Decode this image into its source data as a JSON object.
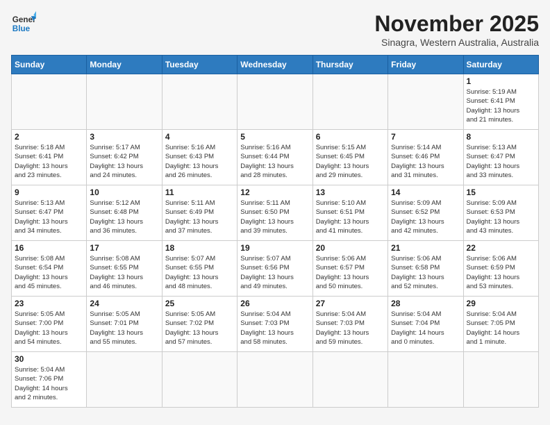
{
  "header": {
    "logo_general": "General",
    "logo_blue": "Blue",
    "month_title": "November 2025",
    "subtitle": "Sinagra, Western Australia, Australia"
  },
  "days_of_week": [
    "Sunday",
    "Monday",
    "Tuesday",
    "Wednesday",
    "Thursday",
    "Friday",
    "Saturday"
  ],
  "weeks": [
    [
      {
        "day": "",
        "info": ""
      },
      {
        "day": "",
        "info": ""
      },
      {
        "day": "",
        "info": ""
      },
      {
        "day": "",
        "info": ""
      },
      {
        "day": "",
        "info": ""
      },
      {
        "day": "",
        "info": ""
      },
      {
        "day": "1",
        "info": "Sunrise: 5:19 AM\nSunset: 6:41 PM\nDaylight: 13 hours\nand 21 minutes."
      }
    ],
    [
      {
        "day": "2",
        "info": "Sunrise: 5:18 AM\nSunset: 6:41 PM\nDaylight: 13 hours\nand 23 minutes."
      },
      {
        "day": "3",
        "info": "Sunrise: 5:17 AM\nSunset: 6:42 PM\nDaylight: 13 hours\nand 24 minutes."
      },
      {
        "day": "4",
        "info": "Sunrise: 5:16 AM\nSunset: 6:43 PM\nDaylight: 13 hours\nand 26 minutes."
      },
      {
        "day": "5",
        "info": "Sunrise: 5:16 AM\nSunset: 6:44 PM\nDaylight: 13 hours\nand 28 minutes."
      },
      {
        "day": "6",
        "info": "Sunrise: 5:15 AM\nSunset: 6:45 PM\nDaylight: 13 hours\nand 29 minutes."
      },
      {
        "day": "7",
        "info": "Sunrise: 5:14 AM\nSunset: 6:46 PM\nDaylight: 13 hours\nand 31 minutes."
      },
      {
        "day": "8",
        "info": "Sunrise: 5:13 AM\nSunset: 6:47 PM\nDaylight: 13 hours\nand 33 minutes."
      }
    ],
    [
      {
        "day": "9",
        "info": "Sunrise: 5:13 AM\nSunset: 6:47 PM\nDaylight: 13 hours\nand 34 minutes."
      },
      {
        "day": "10",
        "info": "Sunrise: 5:12 AM\nSunset: 6:48 PM\nDaylight: 13 hours\nand 36 minutes."
      },
      {
        "day": "11",
        "info": "Sunrise: 5:11 AM\nSunset: 6:49 PM\nDaylight: 13 hours\nand 37 minutes."
      },
      {
        "day": "12",
        "info": "Sunrise: 5:11 AM\nSunset: 6:50 PM\nDaylight: 13 hours\nand 39 minutes."
      },
      {
        "day": "13",
        "info": "Sunrise: 5:10 AM\nSunset: 6:51 PM\nDaylight: 13 hours\nand 41 minutes."
      },
      {
        "day": "14",
        "info": "Sunrise: 5:09 AM\nSunset: 6:52 PM\nDaylight: 13 hours\nand 42 minutes."
      },
      {
        "day": "15",
        "info": "Sunrise: 5:09 AM\nSunset: 6:53 PM\nDaylight: 13 hours\nand 43 minutes."
      }
    ],
    [
      {
        "day": "16",
        "info": "Sunrise: 5:08 AM\nSunset: 6:54 PM\nDaylight: 13 hours\nand 45 minutes."
      },
      {
        "day": "17",
        "info": "Sunrise: 5:08 AM\nSunset: 6:55 PM\nDaylight: 13 hours\nand 46 minutes."
      },
      {
        "day": "18",
        "info": "Sunrise: 5:07 AM\nSunset: 6:55 PM\nDaylight: 13 hours\nand 48 minutes."
      },
      {
        "day": "19",
        "info": "Sunrise: 5:07 AM\nSunset: 6:56 PM\nDaylight: 13 hours\nand 49 minutes."
      },
      {
        "day": "20",
        "info": "Sunrise: 5:06 AM\nSunset: 6:57 PM\nDaylight: 13 hours\nand 50 minutes."
      },
      {
        "day": "21",
        "info": "Sunrise: 5:06 AM\nSunset: 6:58 PM\nDaylight: 13 hours\nand 52 minutes."
      },
      {
        "day": "22",
        "info": "Sunrise: 5:06 AM\nSunset: 6:59 PM\nDaylight: 13 hours\nand 53 minutes."
      }
    ],
    [
      {
        "day": "23",
        "info": "Sunrise: 5:05 AM\nSunset: 7:00 PM\nDaylight: 13 hours\nand 54 minutes."
      },
      {
        "day": "24",
        "info": "Sunrise: 5:05 AM\nSunset: 7:01 PM\nDaylight: 13 hours\nand 55 minutes."
      },
      {
        "day": "25",
        "info": "Sunrise: 5:05 AM\nSunset: 7:02 PM\nDaylight: 13 hours\nand 57 minutes."
      },
      {
        "day": "26",
        "info": "Sunrise: 5:04 AM\nSunset: 7:03 PM\nDaylight: 13 hours\nand 58 minutes."
      },
      {
        "day": "27",
        "info": "Sunrise: 5:04 AM\nSunset: 7:03 PM\nDaylight: 13 hours\nand 59 minutes."
      },
      {
        "day": "28",
        "info": "Sunrise: 5:04 AM\nSunset: 7:04 PM\nDaylight: 14 hours\nand 0 minutes."
      },
      {
        "day": "29",
        "info": "Sunrise: 5:04 AM\nSunset: 7:05 PM\nDaylight: 14 hours\nand 1 minute."
      }
    ],
    [
      {
        "day": "30",
        "info": "Sunrise: 5:04 AM\nSunset: 7:06 PM\nDaylight: 14 hours\nand 2 minutes."
      },
      {
        "day": "",
        "info": ""
      },
      {
        "day": "",
        "info": ""
      },
      {
        "day": "",
        "info": ""
      },
      {
        "day": "",
        "info": ""
      },
      {
        "day": "",
        "info": ""
      },
      {
        "day": "",
        "info": ""
      }
    ]
  ]
}
